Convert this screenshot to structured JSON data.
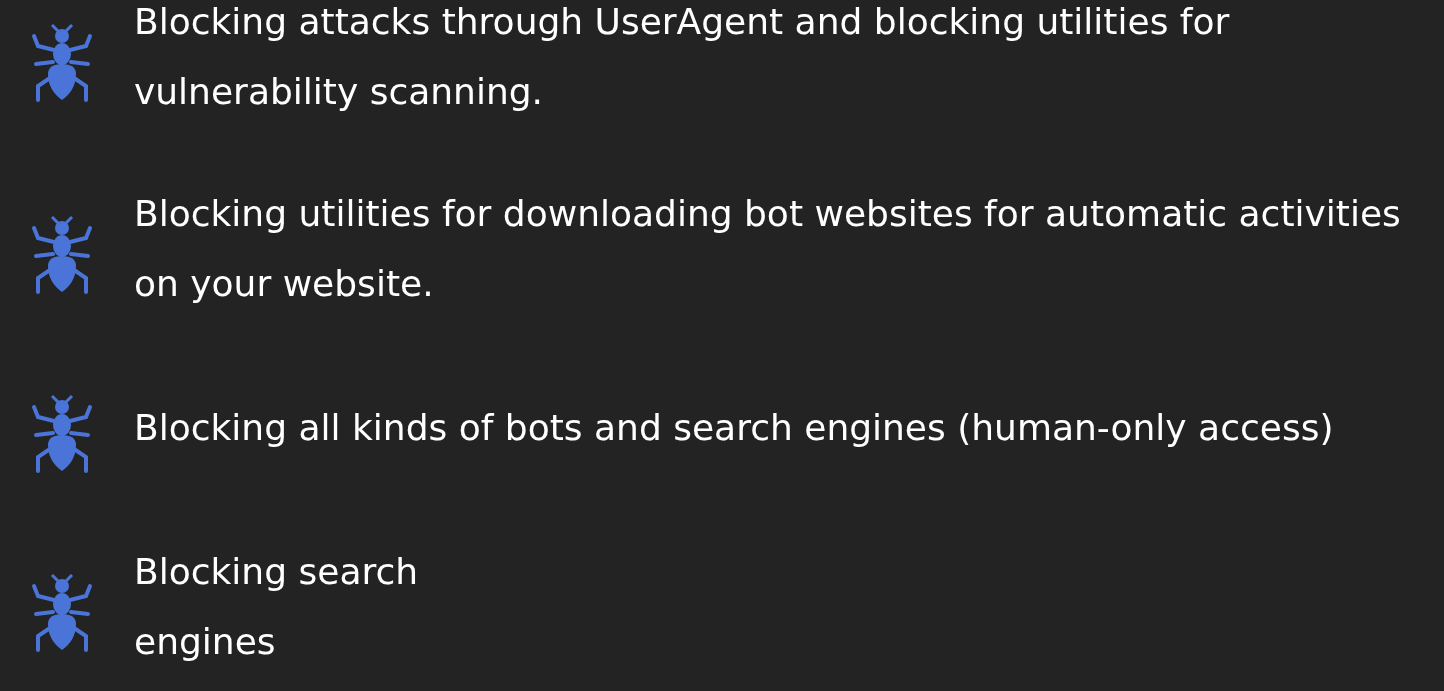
{
  "features": [
    {
      "text": "Blocking attacks through UserAgent and blocking utilities for vulnerability scanning."
    },
    {
      "text": "Blocking utilities for downloading bot websites for automatic activities on your website."
    },
    {
      "text": "Blocking all kinds of bots and search engines (human-only access)"
    },
    {
      "text": "Blocking search engines"
    }
  ]
}
